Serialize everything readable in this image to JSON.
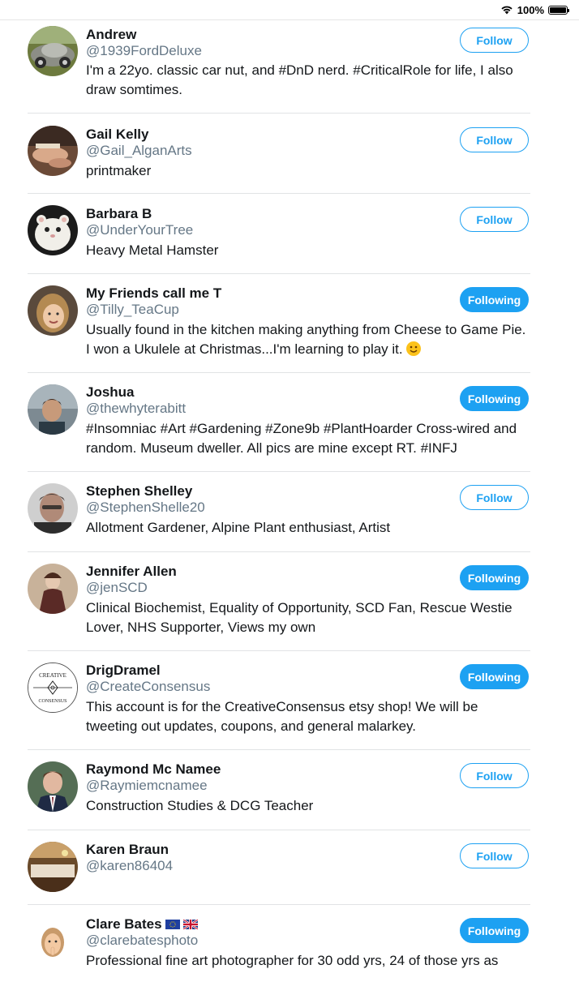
{
  "status_bar": {
    "battery_text": "100%"
  },
  "accounts": [
    {
      "name": "Andrew",
      "handle": "@1939FordDeluxe",
      "bio": "I'm a 22yo. classic car nut, and #DnD nerd. #CriticalRole for life, I also draw somtimes.",
      "button": "Follow"
    },
    {
      "name": "Gail Kelly",
      "handle": "@Gail_AlganArts",
      "bio": "printmaker",
      "button": "Follow"
    },
    {
      "name": "Barbara B",
      "handle": "@UnderYourTree",
      "bio": "Heavy Metal Hamster",
      "button": "Follow"
    },
    {
      "name": "My Friends call me T",
      "handle": "@Tilly_TeaCup",
      "bio": "Usually found in the kitchen making anything from Cheese to Game Pie. I won a Ukulele at Christmas...I'm learning to play it.",
      "button": "Following"
    },
    {
      "name": "Joshua",
      "handle": "@thewhyterabitt",
      "bio": "#Insomniac #Art #Gardening #Zone9b #PlantHoarder Cross-wired and random. Museum dweller. All pics are mine except RT. #INFJ",
      "button": "Following"
    },
    {
      "name": "Stephen Shelley",
      "handle": "@StephenShelle20",
      "bio": "Allotment Gardener, Alpine Plant enthusiast, Artist",
      "button": "Follow"
    },
    {
      "name": "Jennifer Allen",
      "handle": "@jenSCD",
      "bio": "Clinical Biochemist, Equality of Opportunity, SCD Fan, Rescue Westie Lover, NHS Supporter, Views my own",
      "button": "Following"
    },
    {
      "name": "DrigDramel",
      "handle": "@CreateConsensus",
      "bio": "This account is for the CreativeConsensus etsy shop! We will be tweeting out updates, coupons, and general malarkey.",
      "button": "Following",
      "avatar_text_top": "CREATIVE",
      "avatar_text_bottom": "CONSENSUS"
    },
    {
      "name": "Raymond Mc Namee",
      "handle": "@Raymiemcnamee",
      "bio": "Construction Studies & DCG Teacher",
      "button": "Follow"
    },
    {
      "name": "Karen Braun",
      "handle": "@karen86404",
      "bio": "",
      "button": "Follow"
    },
    {
      "name": "Clare Bates",
      "handle": "@clarebatesphoto",
      "bio": "Professional fine art photographer for 30 odd yrs, 24 of those yrs as",
      "button": "Following"
    }
  ],
  "colors": {
    "accent": "#1da1f2",
    "secondary_text": "#657786",
    "divider": "#e1e3e5"
  }
}
